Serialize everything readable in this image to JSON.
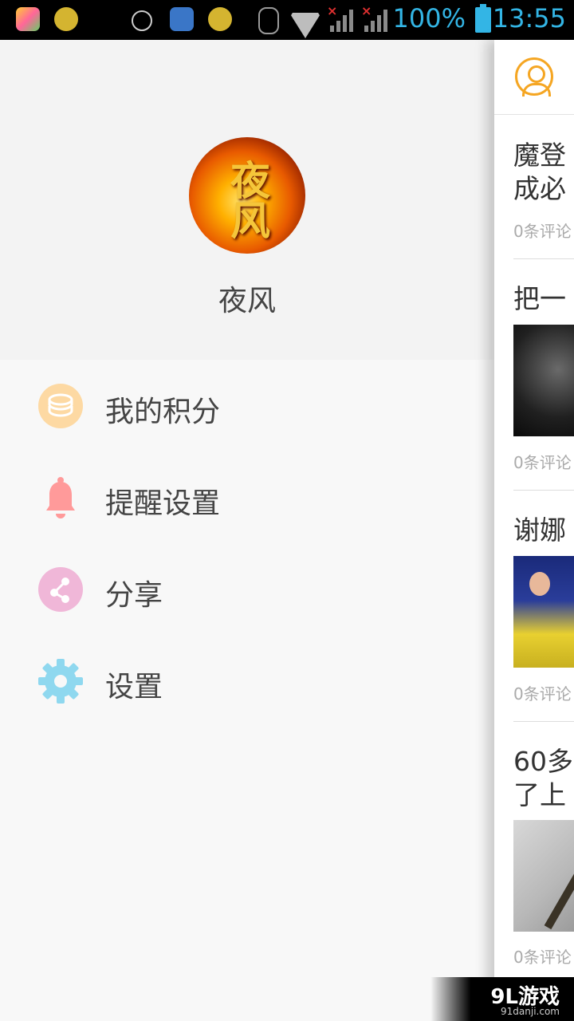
{
  "status_bar": {
    "battery_percent": "100%",
    "time": "13:55"
  },
  "drawer": {
    "username": "夜风",
    "avatar_text": "夜风",
    "menu": [
      {
        "label": "我的积分",
        "icon": "coins-icon",
        "color": "#fdd9a3"
      },
      {
        "label": "提醒设置",
        "icon": "bell-icon",
        "color": "#ff9a9a"
      },
      {
        "label": "分享",
        "icon": "share-icon",
        "color": "#f0b7d8"
      },
      {
        "label": "设置",
        "icon": "gear-icon",
        "color": "#8fd8ef"
      }
    ]
  },
  "content": {
    "accent_color": "#f5a623",
    "articles": [
      {
        "title": "魔登",
        "title_line2": "成必",
        "meta": "0条评论"
      },
      {
        "title": "把一",
        "meta": "0条评论"
      },
      {
        "title": "谢娜",
        "meta": "0条评论"
      },
      {
        "title": "60多",
        "title_line2": "了上",
        "meta": "0条评论"
      }
    ]
  },
  "watermark": {
    "logo": "9L游戏",
    "url": "91danji.com"
  }
}
